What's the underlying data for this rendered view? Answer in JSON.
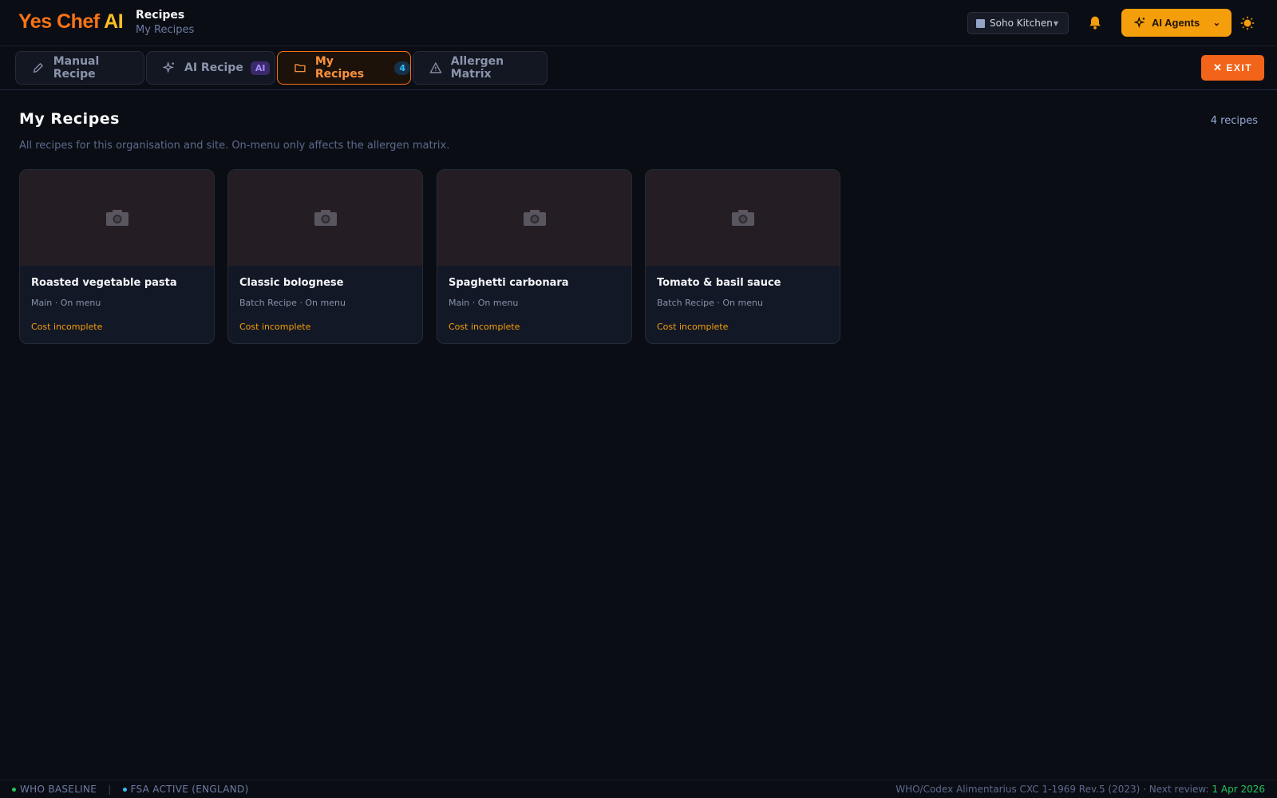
{
  "header": {
    "brand_part1": "Yes Chef",
    "brand_part2": "AI",
    "section_title": "Recipes",
    "section_subtitle": "My Recipes",
    "site_selector": "Soho Kitchen",
    "agents_button": "AI Agents",
    "colors": {
      "primary": "#f97316",
      "accent": "#f59e0b"
    }
  },
  "tabs": [
    {
      "label": "Manual Recipe",
      "icon": "pencil-icon"
    },
    {
      "label": "AI Recipe",
      "icon": "sparkles-icon",
      "badge": "AI"
    },
    {
      "label": "My Recipes",
      "icon": "folder-icon",
      "badge": "4",
      "active": true
    },
    {
      "label": "Allergen Matrix",
      "icon": "warning-triangle-icon"
    }
  ],
  "exit_button": "EXIT",
  "main": {
    "title": "My Recipes",
    "count_label": "4 recipes",
    "subtitle": "All recipes for this organisation and site. On-menu only affects the allergen matrix."
  },
  "recipes": [
    {
      "name": "Roasted vegetable pasta",
      "meta": "Main · On menu",
      "status": "Cost incomplete"
    },
    {
      "name": "Classic bolognese",
      "meta": "Batch Recipe · On menu",
      "status": "Cost incomplete"
    },
    {
      "name": "Spaghetti carbonara",
      "meta": "Main · On menu",
      "status": "Cost incomplete"
    },
    {
      "name": "Tomato & basil sauce",
      "meta": "Batch Recipe · On menu",
      "status": "Cost incomplete"
    }
  ],
  "footer": {
    "status_1": "WHO BASELINE",
    "status_2": "FSA ACTIVE (ENGLAND)",
    "reference": "WHO/Codex Alimentarius CXC 1-1969 Rev.5 (2023) · Next review:",
    "review_date": "1 Apr 2026"
  }
}
